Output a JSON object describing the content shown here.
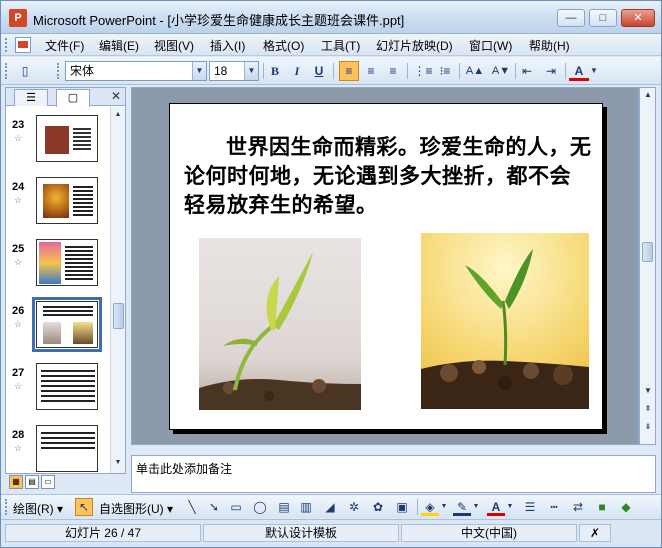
{
  "window": {
    "title": "Microsoft PowerPoint - [小学珍爱生命健康成长主题班会课件.ppt]",
    "app_icon": "P",
    "controls": {
      "minimize": "—",
      "maximize": "□",
      "close": "✕"
    }
  },
  "menu": {
    "items": [
      "文件(F)",
      "编辑(E)",
      "视图(V)",
      "插入(I)",
      "格式(O)",
      "工具(T)",
      "幻灯片放映(D)",
      "窗口(W)",
      "帮助(H)"
    ]
  },
  "format_toolbar": {
    "font_name": "宋体",
    "font_size": "18",
    "bold": "B",
    "italic": "I",
    "underline": "U",
    "align_left": "≡",
    "align_center": "≡",
    "align_right": "≡",
    "numbering": "⋮≡",
    "bullets": "⁝≡",
    "grow_font": "A▲",
    "shrink_font": "A▼",
    "decrease_indent": "⇤",
    "increase_indent": "⇥",
    "font_color": "A"
  },
  "left_pane": {
    "tab_outline": "☰",
    "tab_slides": "▢",
    "close": "✕",
    "slides": [
      {
        "number": "23",
        "icon": "star-icon"
      },
      {
        "number": "24",
        "icon": "star-icon"
      },
      {
        "number": "25",
        "icon": "star-icon"
      },
      {
        "number": "26",
        "icon": "star-icon",
        "selected": true
      },
      {
        "number": "27",
        "icon": "star-icon"
      },
      {
        "number": "28",
        "icon": "star-icon"
      }
    ]
  },
  "slide": {
    "body": "世界因生命而精彩。珍爱生命的人，无论何时何地，无论遇到多大挫折，都不会轻易放弃生的希望。"
  },
  "notes": {
    "placeholder": "单击此处添加备注"
  },
  "draw_toolbar": {
    "draw_menu": "绘图(R) ▾",
    "autoshapes_menu": "自选图形(U) ▾"
  },
  "status": {
    "slide_counter": "幻灯片 26 / 47",
    "design_template": "默认设计模板",
    "language": "中文(中国)"
  },
  "colors": {
    "accent_highlight": "#ffc15c",
    "selection_outline": "#3c6fb4",
    "slide_area_background": "#8d9aab"
  }
}
